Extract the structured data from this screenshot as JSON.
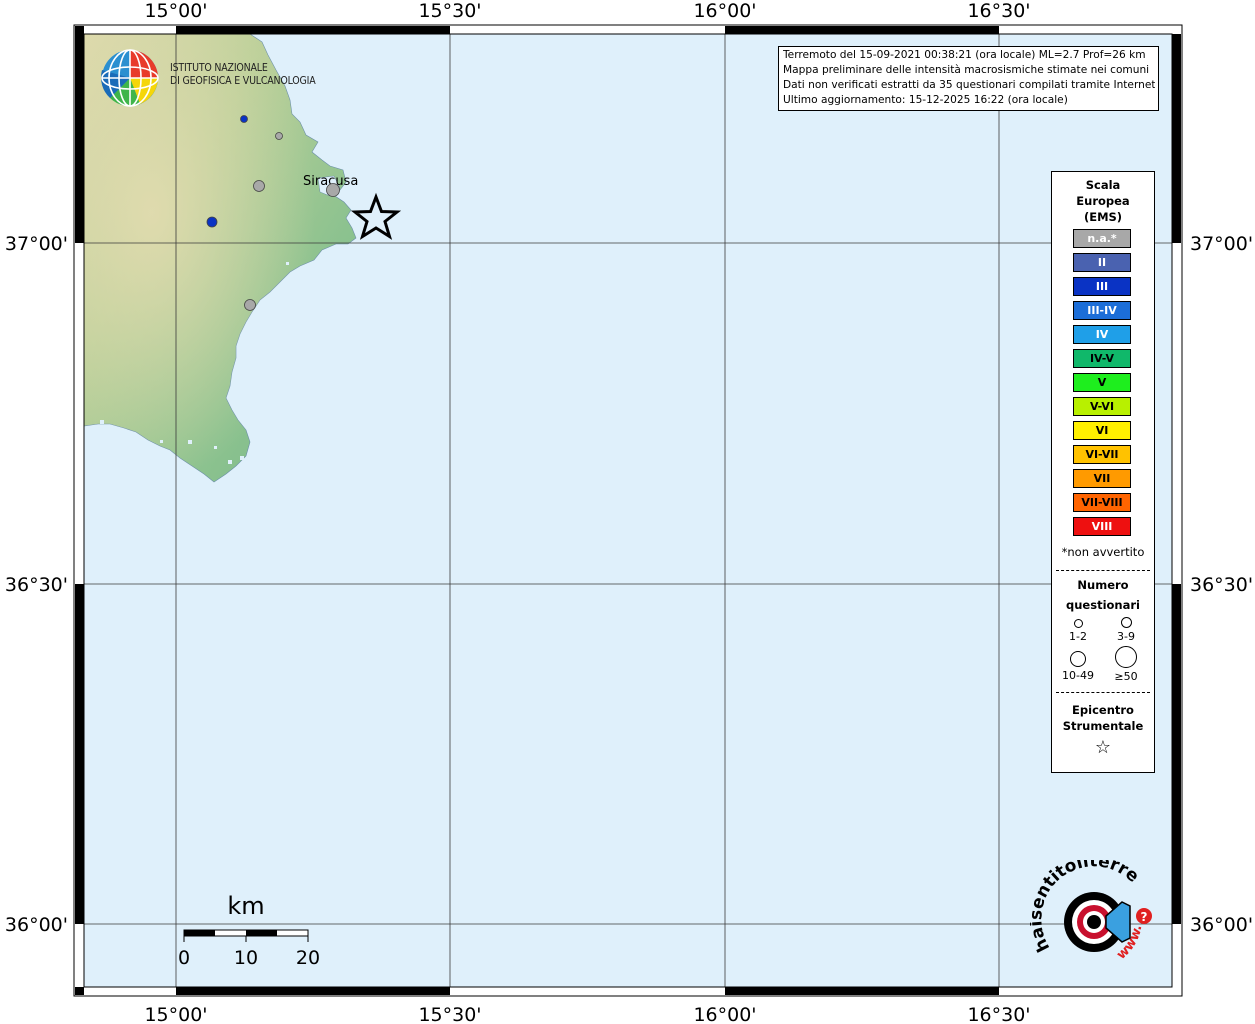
{
  "header_info": {
    "line1": "Terremoto del 15-09-2021 00:38:21 (ora locale) ML=2.7 Prof=26 km",
    "line2": "Mappa preliminare delle intensità macrosismiche stimate nei comuni",
    "line3": "Dati non verificati estratti da 35 questionari compilati tramite Internet.",
    "line4": "Ultimo aggiornamento: 15-12-2025 16:22 (ora locale)"
  },
  "axes": {
    "top_labels": [
      "15°00'",
      "15°30'",
      "16°00'",
      "16°30'"
    ],
    "bottom_labels": [
      "15°00'",
      "15°30'",
      "16°00'",
      "16°30'"
    ],
    "left_labels": [
      "37°00'",
      "36°30'",
      "36°00'"
    ],
    "right_labels": [
      "37°00'",
      "36°30'",
      "36°00'"
    ]
  },
  "place_label": "Siracusa",
  "ingv_logo": {
    "line1": "ISTITUTO NAZIONALE",
    "line2": "DI GEOFISICA E VULCANOLOGIA"
  },
  "scale_bar": {
    "unit": "km",
    "ticks": [
      "0",
      "10",
      "20"
    ]
  },
  "legend": {
    "title_line1": "Scala",
    "title_line2": "Europea",
    "title_line3": "(EMS)",
    "classes": [
      {
        "label": "n.a.*",
        "color": "#a8a8a8",
        "text": "#ffffff"
      },
      {
        "label": "II",
        "color": "#4a62b0",
        "text": "#ffffff"
      },
      {
        "label": "III",
        "color": "#0a33c4",
        "text": "#ffffff"
      },
      {
        "label": "III-IV",
        "color": "#1c6ed8",
        "text": "#ffffff"
      },
      {
        "label": "IV",
        "color": "#1f9fe8",
        "text": "#ffffff"
      },
      {
        "label": "IV-V",
        "color": "#10b86a",
        "text": "#000000"
      },
      {
        "label": "V",
        "color": "#1eee1e",
        "text": "#000000"
      },
      {
        "label": "V-VI",
        "color": "#b8f000",
        "text": "#000000"
      },
      {
        "label": "VI",
        "color": "#fff000",
        "text": "#000000"
      },
      {
        "label": "VI-VII",
        "color": "#ffc200",
        "text": "#000000"
      },
      {
        "label": "VII",
        "color": "#ff9a00",
        "text": "#000000"
      },
      {
        "label": "VII-VIII",
        "color": "#ff6400",
        "text": "#000000"
      },
      {
        "label": "VIII",
        "color": "#ee1010",
        "text": "#ffffff"
      }
    ],
    "note": "*non avvertito",
    "count_title_line1": "Numero",
    "count_title_line2": "questionari",
    "count_sizes": [
      "1-2",
      "3-9",
      "10-49",
      "≥50"
    ],
    "epicenter_line1": "Epicentro",
    "epicenter_line2": "Strumentale",
    "epicenter_symbol": "☆"
  },
  "observations": [
    {
      "intensity": "III",
      "questionnaires": "1-2"
    },
    {
      "intensity": "n.a.*",
      "questionnaires": "1-2"
    },
    {
      "intensity": "n.a.*",
      "questionnaires": "3-9"
    },
    {
      "intensity": "n.a.*",
      "questionnaires": "3-9"
    },
    {
      "intensity": "III",
      "questionnaires": "3-9"
    },
    {
      "intensity": "n.a.*",
      "questionnaires": "3-9"
    }
  ],
  "epicenter": {
    "symbol": "star"
  },
  "colors": {
    "sea": "#dff0fb",
    "frame_dark": "#000000",
    "land_low": "#7fb88a",
    "land_mid": "#a9c98e",
    "land_high": "#d8d7a8"
  },
  "hsit_logo": {
    "text": "haisentitoilterremoto.it",
    "www": "www."
  }
}
